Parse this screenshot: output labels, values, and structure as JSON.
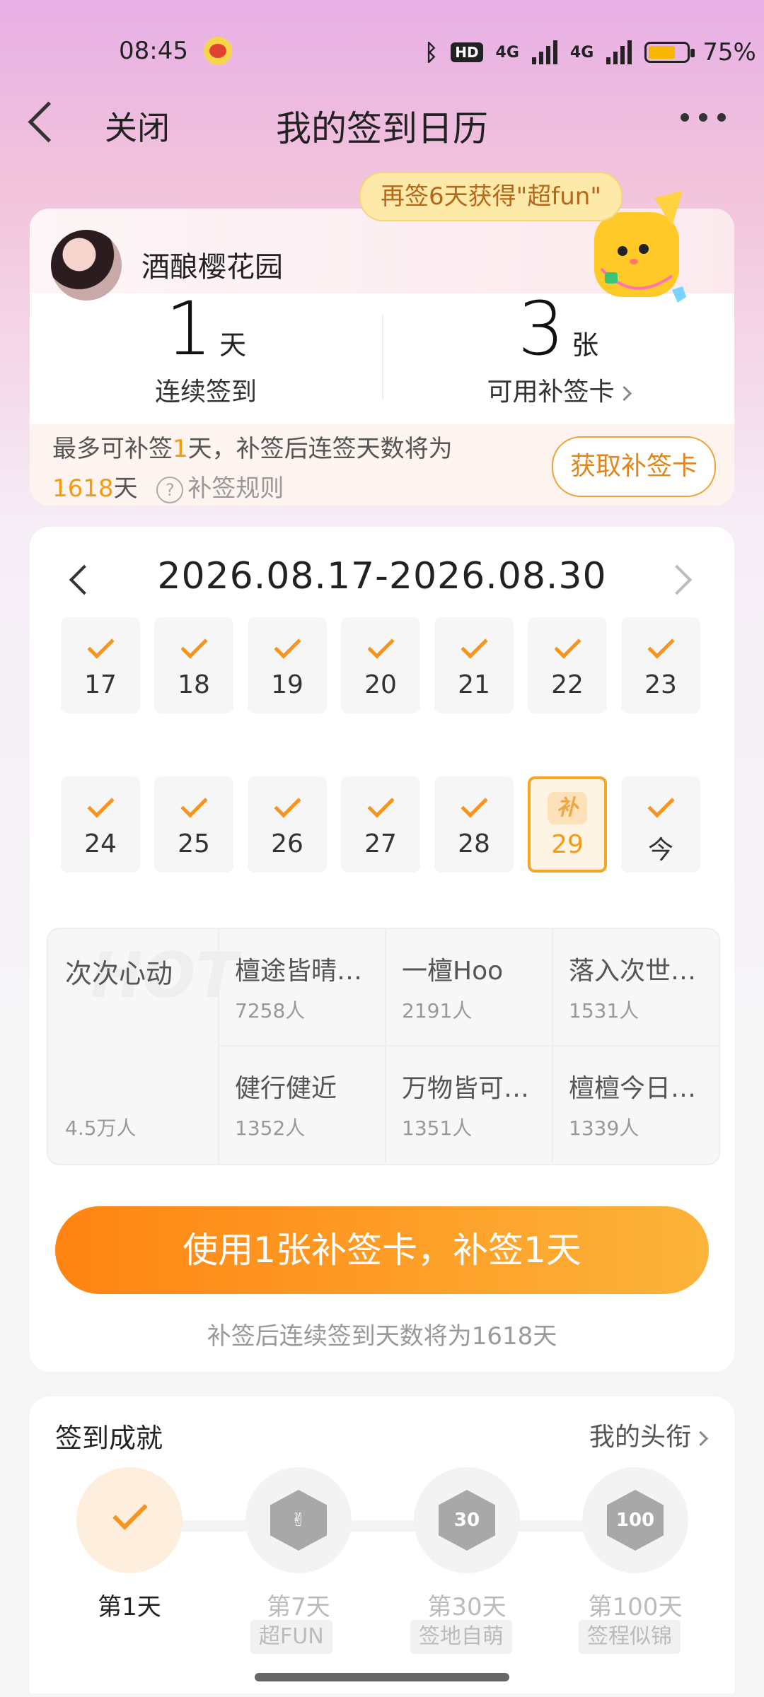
{
  "status_bar": {
    "time": "08:45",
    "hd": "HD",
    "network_1": "4G",
    "network_2": "4G",
    "battery": "75%"
  },
  "nav": {
    "close": "关闭",
    "title": "我的签到日历"
  },
  "promo": {
    "text": "再签6天获得\"超fun\""
  },
  "profile": {
    "username": "酒酿樱花园",
    "streak_value": "1",
    "streak_unit": "天",
    "streak_label": "连续签到",
    "cards_value": "3",
    "cards_unit": "张",
    "cards_label": "可用补签卡",
    "makeup_prefix": "最多可补签",
    "makeup_days": "1",
    "makeup_mid": "天，补签后连签天数将为",
    "makeup_total": "1618",
    "makeup_total_unit": "天",
    "rules": "补签规则",
    "get_card": "获取补签卡"
  },
  "calendar": {
    "range": "2026.08.17-2026.08.30",
    "days": [
      {
        "label": "17",
        "state": "checked"
      },
      {
        "label": "18",
        "state": "checked"
      },
      {
        "label": "19",
        "state": "checked"
      },
      {
        "label": "20",
        "state": "checked"
      },
      {
        "label": "21",
        "state": "checked"
      },
      {
        "label": "22",
        "state": "checked"
      },
      {
        "label": "23",
        "state": "checked"
      },
      {
        "label": "24",
        "state": "checked"
      },
      {
        "label": "25",
        "state": "checked"
      },
      {
        "label": "26",
        "state": "checked"
      },
      {
        "label": "27",
        "state": "checked"
      },
      {
        "label": "28",
        "state": "checked"
      },
      {
        "label": "29",
        "state": "makeup",
        "tag": "补"
      },
      {
        "label": "今",
        "state": "checked"
      }
    ]
  },
  "topics": {
    "hot": {
      "watermark": "HOT",
      "title": "次次心动",
      "count": "4.5万人"
    },
    "items": [
      {
        "title": "檀途皆晴…",
        "count": "7258人"
      },
      {
        "title": "一檀Hoo",
        "count": "2191人"
      },
      {
        "title": "落入次世…",
        "count": "1531人"
      },
      {
        "title": "健行健近",
        "count": "1352人"
      },
      {
        "title": "万物皆可…",
        "count": "1351人"
      },
      {
        "title": "檀檀今日…",
        "count": "1339人"
      }
    ]
  },
  "action": {
    "button": "使用1张补签卡，补签1天",
    "note": "补签后连续签到天数将为1618天"
  },
  "achievements": {
    "title": "签到成就",
    "link": "我的头衔",
    "medals": [
      {
        "label": "第1天",
        "name": "",
        "icon": "check-icon",
        "active": true
      },
      {
        "label": "第7天",
        "name": "超FUN",
        "icon": "rock-hand-badge-icon",
        "active": false
      },
      {
        "label": "第30天",
        "name": "签地自萌",
        "icon": "30-days-badge-icon",
        "badge": "30",
        "active": false
      },
      {
        "label": "第100天",
        "name": "签程似锦",
        "icon": "100-days-badge-icon",
        "badge": "100",
        "active": false
      }
    ]
  },
  "colors": {
    "accent": "#f7941d",
    "button_start": "#ff8412",
    "button_end": "#fcb43a"
  }
}
